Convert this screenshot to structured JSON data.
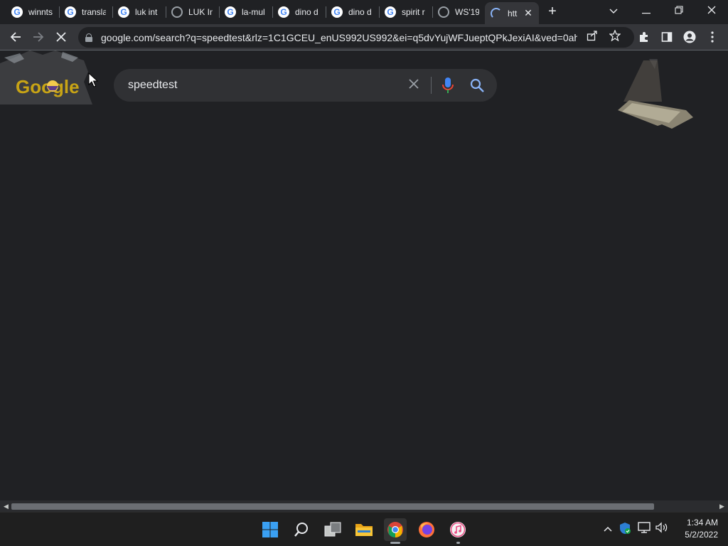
{
  "browser": {
    "tabs": [
      {
        "label": "winnts",
        "favicon": "google-g-icon"
      },
      {
        "label": "transla",
        "favicon": "google-g-icon"
      },
      {
        "label": "luk int",
        "favicon": "google-g-icon"
      },
      {
        "label": "LUK In",
        "favicon": "globe-icon"
      },
      {
        "label": "la-mul",
        "favicon": "google-g-icon"
      },
      {
        "label": "dino d",
        "favicon": "google-g-icon"
      },
      {
        "label": "dino d",
        "favicon": "google-g-icon"
      },
      {
        "label": "spirit r",
        "favicon": "google-g-icon"
      },
      {
        "label": "WS'19",
        "favicon": "globe-icon"
      },
      {
        "label": "htt",
        "favicon": "loading-spinner-icon",
        "active": true
      }
    ],
    "new_tab_label": "+",
    "address": "google.com/search?q=speedtest&rlz=1C1GCEU_enUS992US992&ei=q5dvYujWFJueptQPkJexiAI&ved=0ah..."
  },
  "page": {
    "search_query": "speedtest",
    "doodle_text": "Google"
  },
  "taskbar": {
    "time": "1:34 AM",
    "date": "5/2/2022"
  },
  "colors": {
    "background": "#202124",
    "toolbar": "#35363a",
    "searchbox": "#303134",
    "accent_blue": "#8ab4f8",
    "mic_blue": "#4285f4",
    "mic_red": "#ea4335"
  }
}
